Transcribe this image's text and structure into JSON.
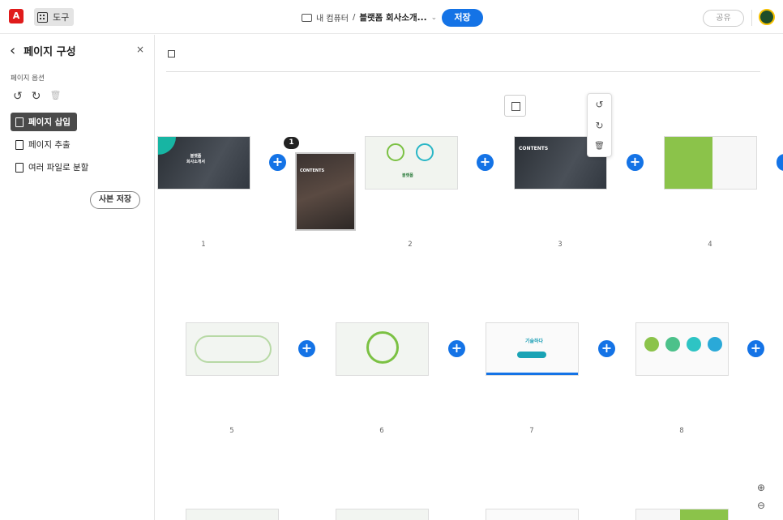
{
  "topbar": {
    "tools_label": "도구",
    "location": "내 컴퓨터",
    "separator": "/",
    "doc_name": "블랫폼 회사소개...",
    "chevron": "⌄",
    "save_label": "저장",
    "share_label": "공유"
  },
  "sidebar": {
    "back": "‹",
    "title": "페이지 구성",
    "close": "×",
    "options_label": "페이지 옵션",
    "items": [
      {
        "label": "페이지 삽입",
        "active": true
      },
      {
        "label": "페이지 추출",
        "active": false
      },
      {
        "label": "여러 파일로 분할",
        "active": false
      }
    ],
    "copy_save_label": "사본 저장"
  },
  "pages": {
    "numbers": [
      "1",
      "2",
      "3",
      "4",
      "5",
      "6",
      "7",
      "8"
    ],
    "drag_badge": "1",
    "thumb_texts": {
      "p1": "블랫폼\n회사소개서",
      "p3": "CONTENTS",
      "p7": "기술하다",
      "p2_brand": "블랫폼"
    }
  },
  "icons": {
    "plus": "+",
    "rotate_left": "↺",
    "rotate_right": "↻",
    "trash": "🗑",
    "zoom_in": "⊕",
    "zoom_out": "⊖"
  },
  "colors": {
    "accent": "#1473e6",
    "acrobat_red": "#e01b1b",
    "active_item": "#4a4a4a"
  }
}
